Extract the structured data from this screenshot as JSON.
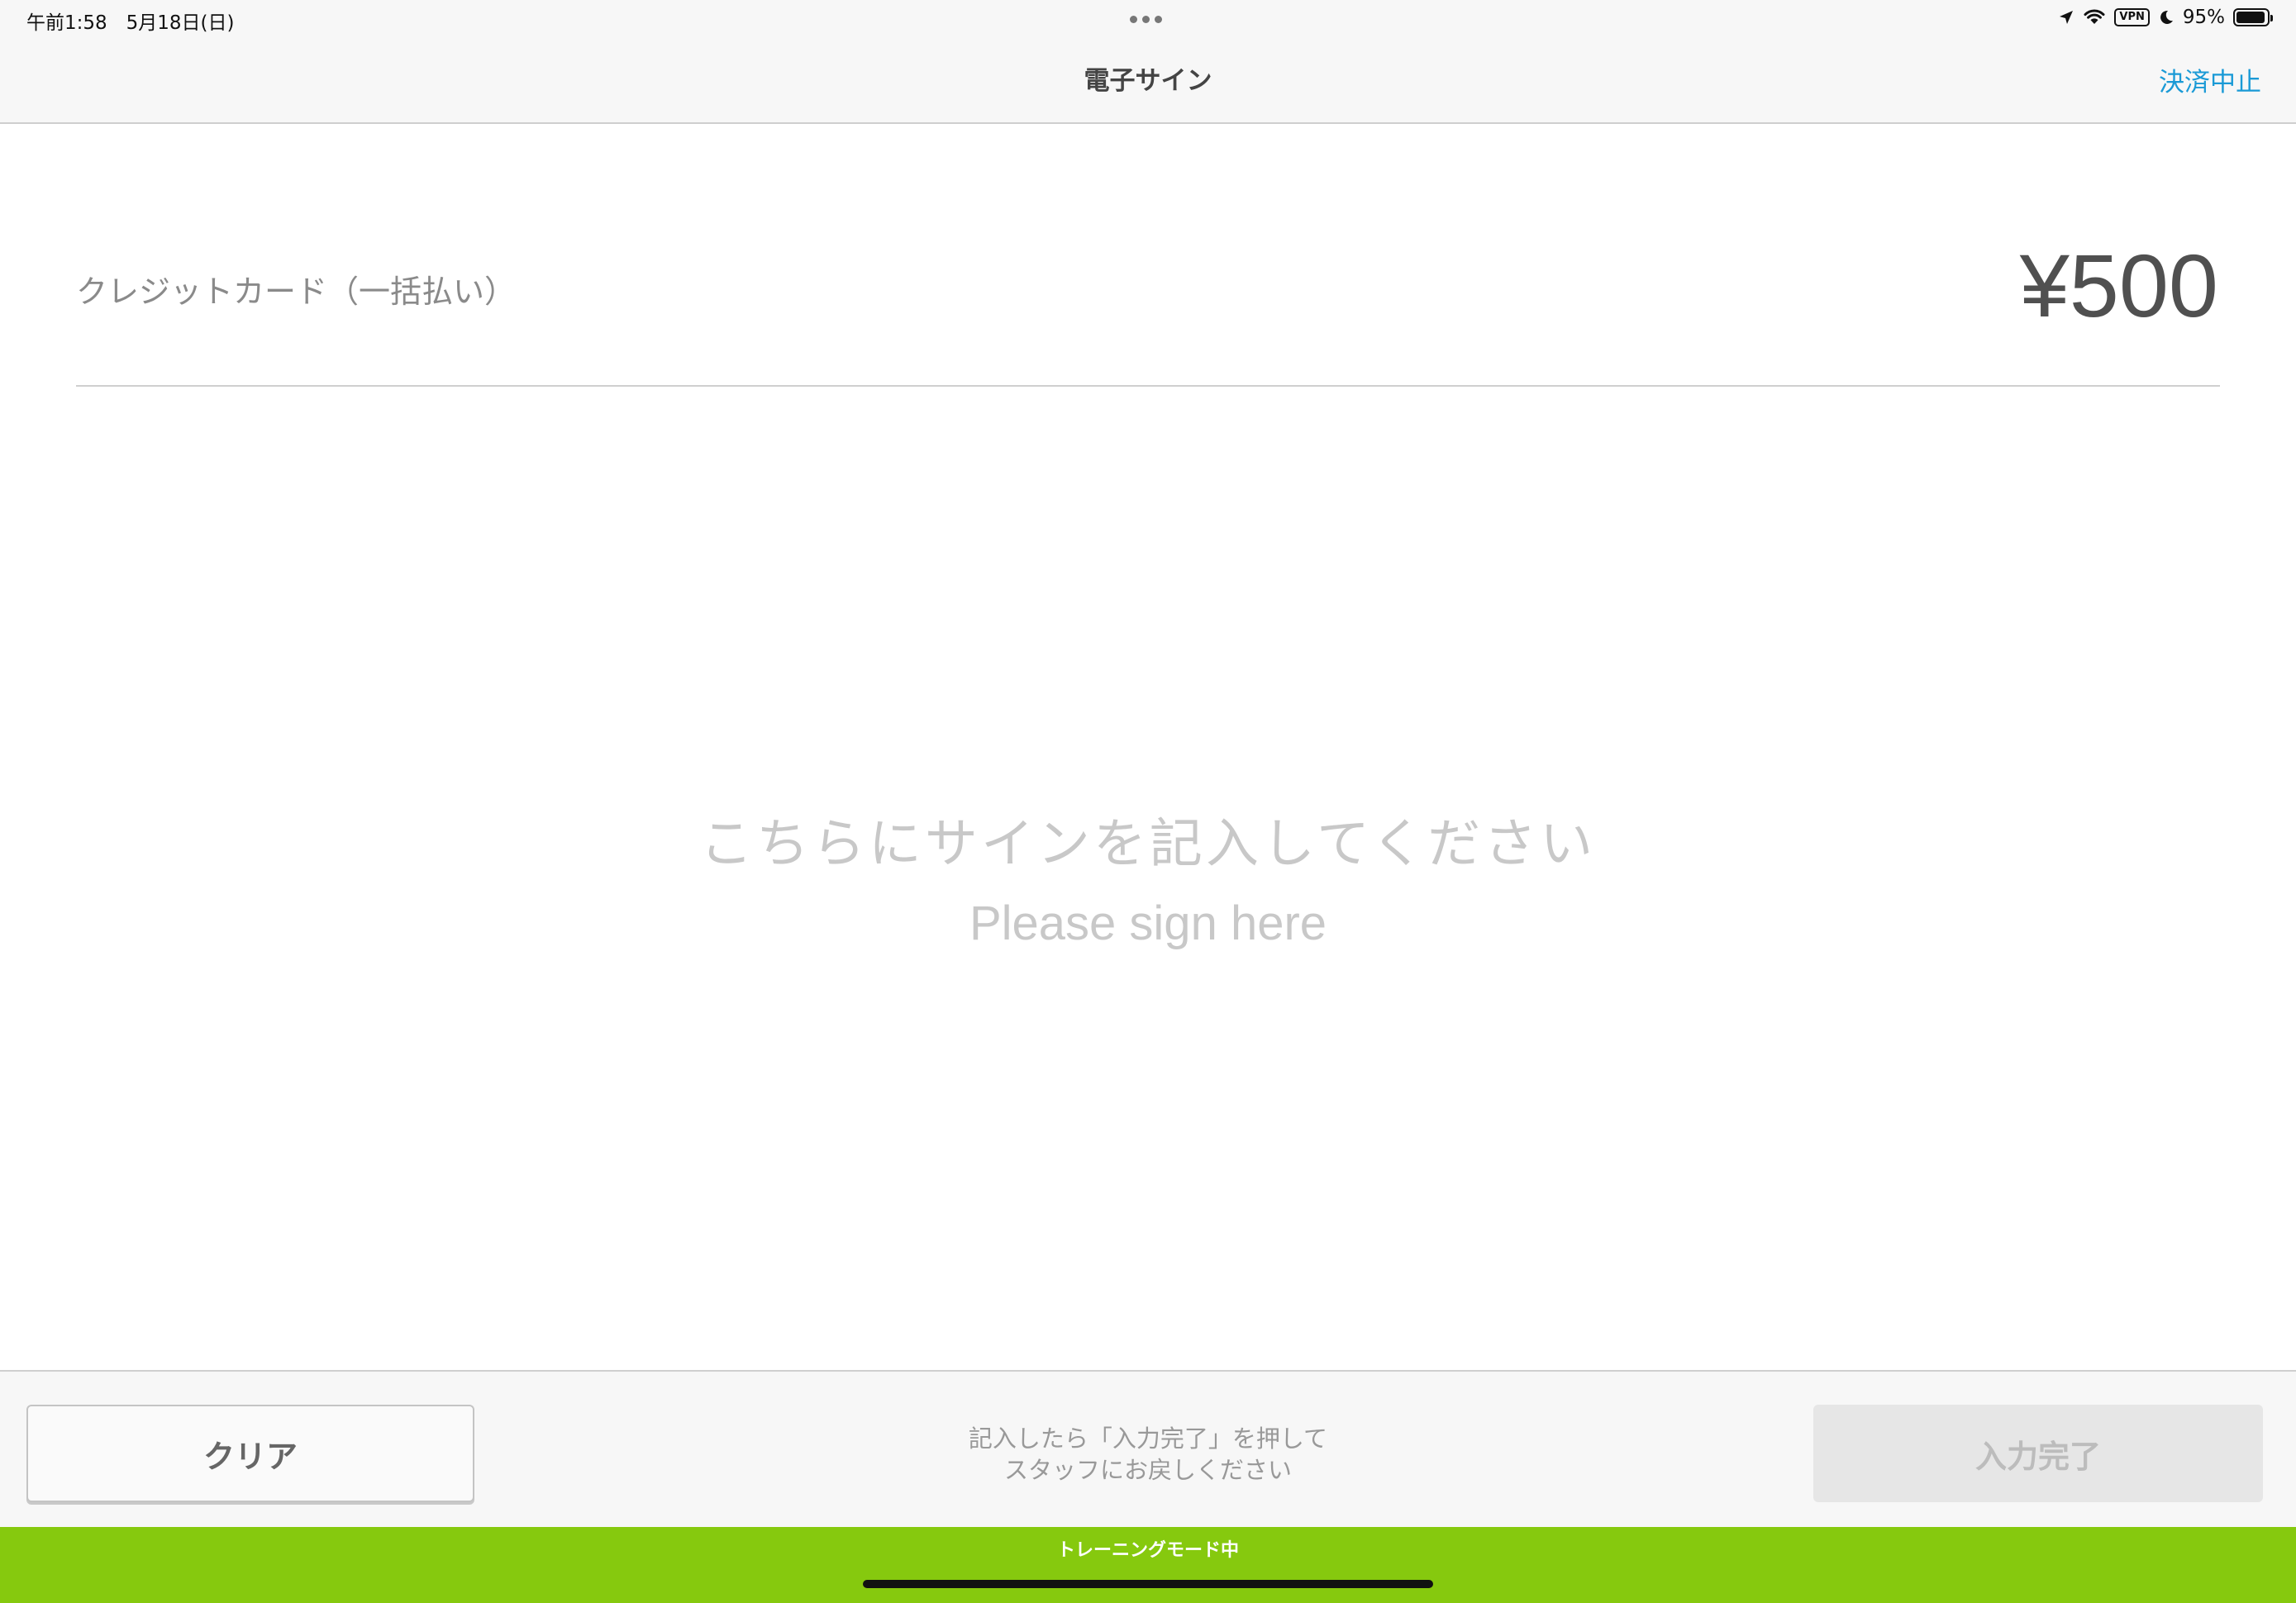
{
  "status_bar": {
    "time_date": "午前1:58　5月18日(日)",
    "vpn": "VPN",
    "battery": "95%",
    "battery_level": 0.95
  },
  "nav": {
    "title": "電子サイン",
    "cancel_label": "決済中止"
  },
  "payment": {
    "method": "クレジットカード（一括払い）",
    "amount": "¥500"
  },
  "signature": {
    "prompt_ja": "こちらにサインを記入してください",
    "prompt_en": "Please sign here"
  },
  "toolbar": {
    "clear_label": "クリア",
    "instruction_line1": "記入したら「入力完了」を押して",
    "instruction_line2": "スタッフにお戻しください",
    "done_label": "入力完了"
  },
  "banner": {
    "training_label": "トレーニングモード中",
    "color": "#86c90e"
  },
  "colors": {
    "accent": "#1a9ad6"
  }
}
